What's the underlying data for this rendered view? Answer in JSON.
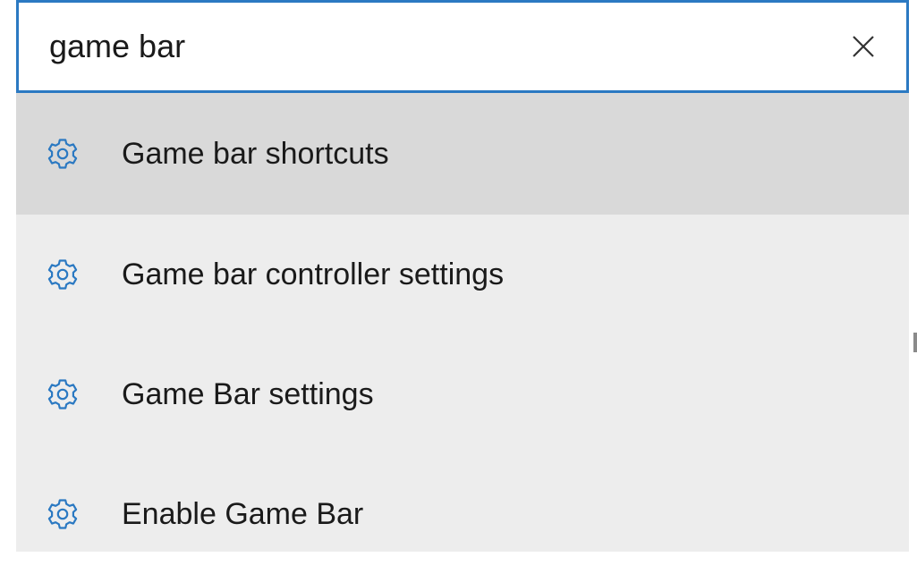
{
  "search": {
    "value": "game bar",
    "placeholder": ""
  },
  "results": [
    {
      "label": "Game bar shortcuts",
      "icon": "gear-icon",
      "selected": true
    },
    {
      "label": "Game bar controller settings",
      "icon": "gear-icon",
      "selected": false
    },
    {
      "label": "Game Bar settings",
      "icon": "gear-icon",
      "selected": false
    },
    {
      "label": "Enable Game Bar",
      "icon": "gear-icon",
      "selected": false
    }
  ],
  "colors": {
    "accent": "#2b79c2",
    "selected_bg": "#d9d9d9",
    "list_bg": "#ededed",
    "icon": "#2b79c2"
  }
}
